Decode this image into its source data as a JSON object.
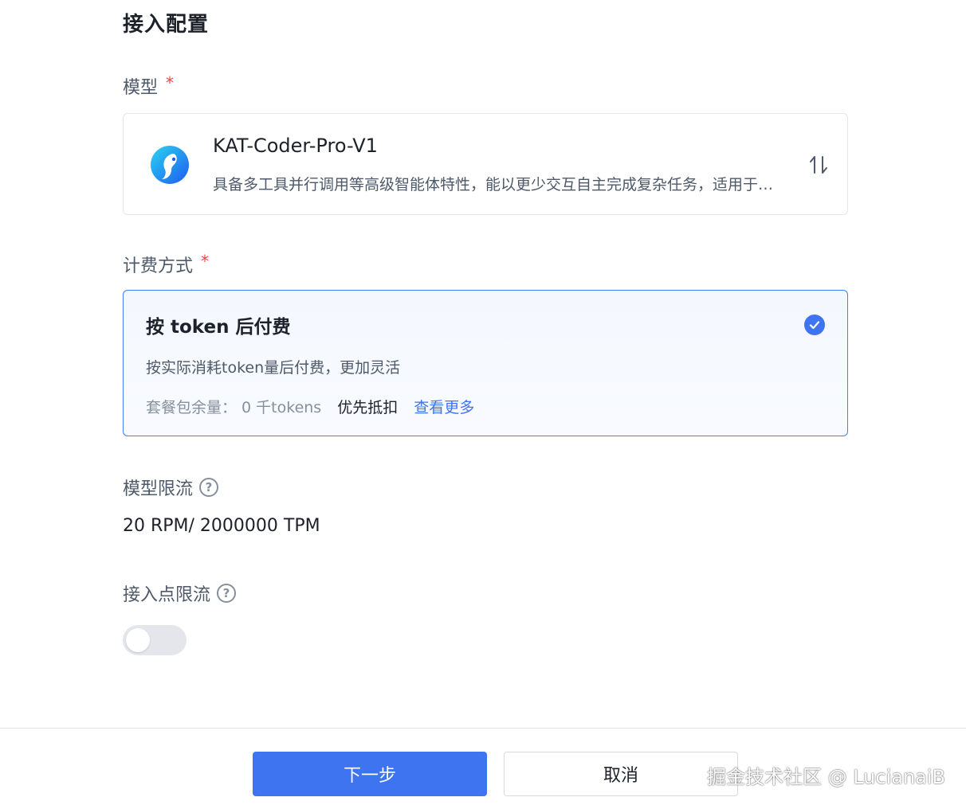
{
  "page": {
    "title": "接入配置"
  },
  "model_field": {
    "label": "模型",
    "required_mark": "*",
    "selected": {
      "name": "KAT-Coder-Pro-V1",
      "description": "具备多工具并行调用等高级智能体特性，能以更少交互自主完成复杂任务，适用于真实软件工程场景",
      "logo_icon": "kat-coder-logo-icon",
      "swap_icon": "swap-vertical-icon"
    }
  },
  "billing_field": {
    "label": "计费方式",
    "required_mark": "*",
    "option": {
      "title": "按 token 后付费",
      "description": "按实际消耗token量后付费，更加灵活",
      "quota": "套餐包余量： 0 千tokens",
      "priority": "优先抵扣",
      "link": "查看更多",
      "selected": true,
      "check_icon": "check-circle-icon"
    }
  },
  "model_rate_limit": {
    "label": "模型限流",
    "help_icon": "question-circle-icon",
    "value": "20 RPM/ 2000000 TPM"
  },
  "endpoint_rate_limit": {
    "label": "接入点限流",
    "help_icon": "question-circle-icon",
    "enabled": false
  },
  "footer": {
    "next_label": "下一步",
    "cancel_label": "取消"
  },
  "watermark": "掘金技术社区 @ LucianaiB",
  "colors": {
    "primary": "#3f74f0",
    "required": "#f53f3f",
    "border_selected": "#4080ff"
  }
}
